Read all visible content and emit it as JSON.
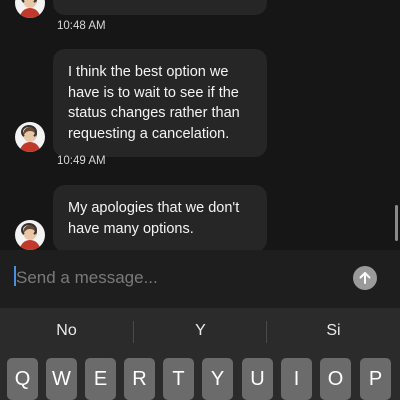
{
  "messages": [
    {
      "text": "I think the best option we have is to wait to see if the status changes rather than requesting a cancelation."
    },
    {
      "text": "My apologies that we don't have many options."
    }
  ],
  "timestamps": [
    "10:48 AM",
    "10:49 AM"
  ],
  "composer": {
    "placeholder": "Send a message..."
  },
  "suggestions": [
    "No",
    "Y",
    "Si"
  ],
  "keyboard": {
    "row1": [
      "Q",
      "W",
      "E",
      "R",
      "T",
      "Y",
      "U",
      "I",
      "O",
      "P"
    ]
  },
  "colors": {
    "background": "#161616",
    "bubble": "#262626",
    "caret": "#4a90e2",
    "key": "#6b6b6b"
  }
}
